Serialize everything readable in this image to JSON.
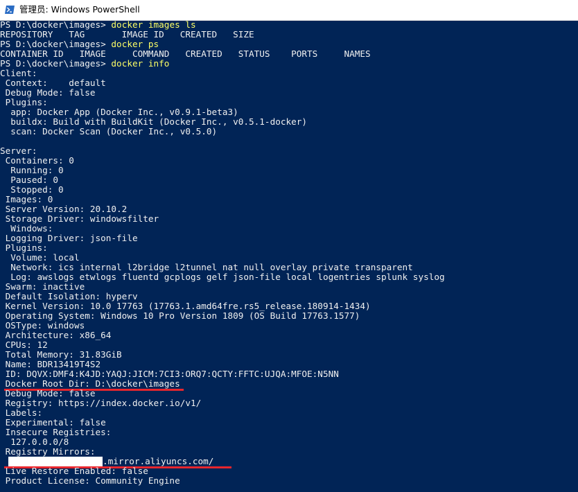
{
  "window": {
    "title": "管理员: Windows PowerShell",
    "icon": "powershell-icon"
  },
  "colors": {
    "background": "#012456",
    "text": "#f0f0f0",
    "command": "#ffff66",
    "annotation": "#e8262d"
  },
  "console": {
    "l1_prompt": "PS D:\\docker\\images> ",
    "l1_cmd": "docker images ls",
    "l2": "REPOSITORY   TAG       IMAGE ID   CREATED   SIZE",
    "l3_prompt": "PS D:\\docker\\images> ",
    "l3_cmd": "docker ps",
    "l4": "CONTAINER ID   IMAGE     COMMAND   CREATED   STATUS    PORTS     NAMES",
    "l5_prompt": "PS D:\\docker\\images> ",
    "l5_cmd": "docker info",
    "l6": "Client:",
    "l7": " Context:    default",
    "l8": " Debug Mode: false",
    "l9": " Plugins:",
    "l10": "  app: Docker App (Docker Inc., v0.9.1-beta3)",
    "l11": "  buildx: Build with BuildKit (Docker Inc., v0.5.1-docker)",
    "l12": "  scan: Docker Scan (Docker Inc., v0.5.0)",
    "l13": "",
    "l14": "Server:",
    "l15": " Containers: 0",
    "l16": "  Running: 0",
    "l17": "  Paused: 0",
    "l18": "  Stopped: 0",
    "l19": " Images: 0",
    "l20": " Server Version: 20.10.2",
    "l21": " Storage Driver: windowsfilter",
    "l22": "  Windows:",
    "l23": " Logging Driver: json-file",
    "l24": " Plugins:",
    "l25": "  Volume: local",
    "l26": "  Network: ics internal l2bridge l2tunnel nat null overlay private transparent",
    "l27": "  Log: awslogs etwlogs fluentd gcplogs gelf json-file local logentries splunk syslog",
    "l28": " Swarm: inactive",
    "l29": " Default Isolation: hyperv",
    "l30": " Kernel Version: 10.0 17763 (17763.1.amd64fre.rs5_release.180914-1434)",
    "l31": " Operating System: Windows 10 Pro Version 1809 (OS Build 17763.1577)",
    "l32": " OSType: windows",
    "l33": " Architecture: x86_64",
    "l34": " CPUs: 12",
    "l35": " Total Memory: 31.83GiB",
    "l36": " Name: BDR13419T4S2",
    "l37": " ID: DQVX:DMF4:K4JD:YAQJ:JICM:7CI3:ORQ7:QCTY:FFTC:UJQA:MFOE:N5NN",
    "l38": " Docker Root Dir: D:\\docker\\images",
    "l39": " Debug Mode: false",
    "l40": " Registry: https://index.docker.io/v1/",
    "l41": " Labels:",
    "l42": " Experimental: false",
    "l43": " Insecure Registries:",
    "l44": "  127.0.0.0/8",
    "l45": " Registry Mirrors:",
    "l46_suffix": ".mirror.aliyuncs.com/",
    "l47": " Live Restore Enabled: false",
    "l48": " Product License: Community Engine"
  }
}
